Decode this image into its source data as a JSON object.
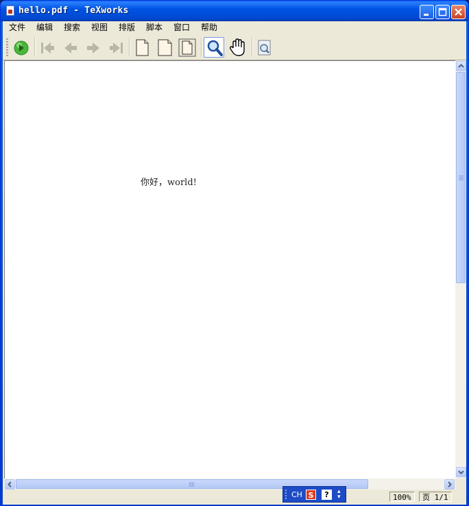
{
  "window": {
    "title": "hello.pdf - TeXworks"
  },
  "menu": [
    "文件",
    "编辑",
    "搜索",
    "视图",
    "排版",
    "脚本",
    "窗口",
    "帮助"
  ],
  "toolbar": {
    "typeset": "typeset-play-icon",
    "nav": [
      "first-page-icon",
      "previous-page-icon",
      "next-page-icon",
      "last-page-icon"
    ],
    "view": [
      "actual-size-icon",
      "fit-width-icon",
      "fit-window-icon"
    ],
    "tools": [
      "magnify-tool-icon",
      "scroll-hand-icon"
    ],
    "find": "find-in-source-icon"
  },
  "document": {
    "text": "你好，world!"
  },
  "status": {
    "zoom": "100%",
    "page": "页 1/1"
  },
  "ime": {
    "lang": "CH",
    "brand": "S",
    "help": "?"
  },
  "colors": {
    "titlebar": "#0054e3",
    "chrome": "#ece9d8",
    "close": "#c94421",
    "typeset": "#4ab53a"
  }
}
